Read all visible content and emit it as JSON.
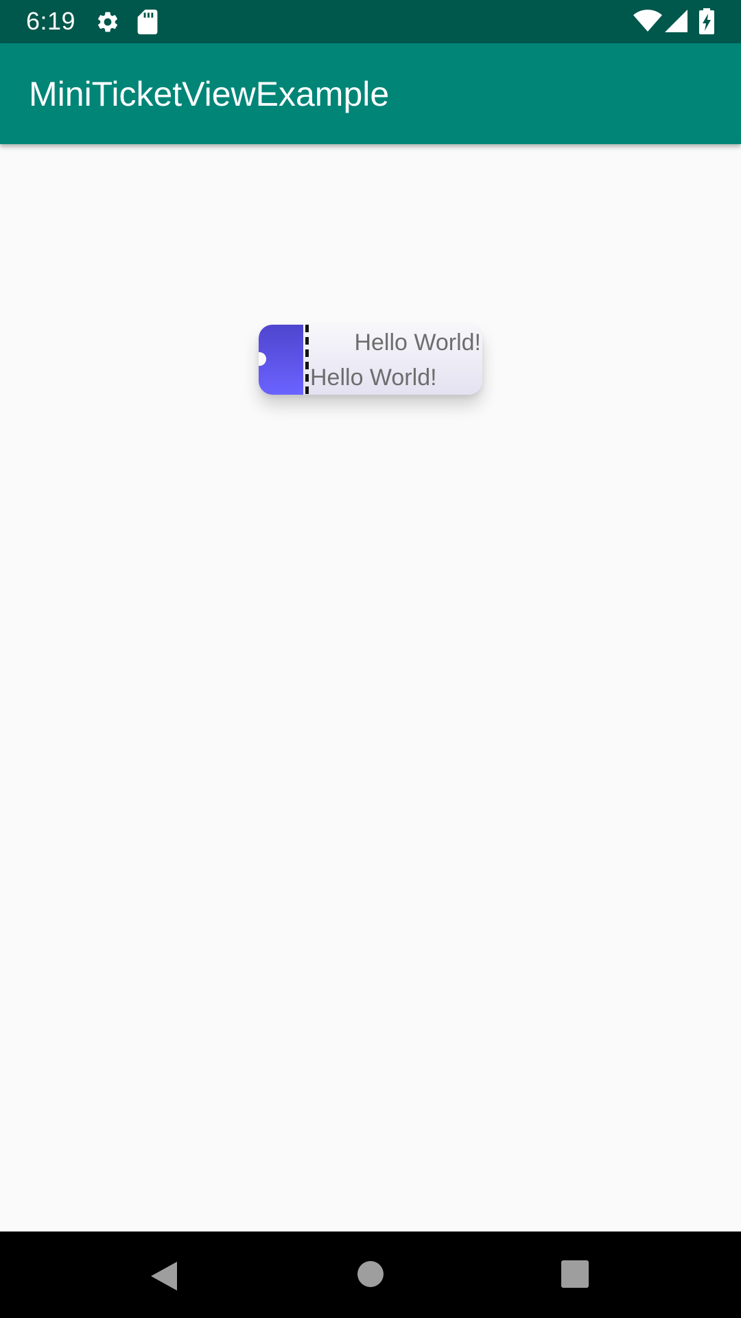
{
  "status_bar": {
    "time": "6:19",
    "icons": [
      "settings-icon",
      "sd-card-icon",
      "wifi-icon",
      "cell-signal-icon",
      "battery-charging-icon"
    ],
    "background": "#00574b"
  },
  "app_bar": {
    "title": "MiniTicketViewExample",
    "background": "#008577"
  },
  "ticket": {
    "line_1": "Hello World!",
    "line_2": "Hello World!",
    "stub_color_top": "#4f45cf",
    "stub_color_bottom": "#6b63ff",
    "text_color": "#6d6d6d"
  },
  "nav_bar": {
    "buttons": [
      "back-icon",
      "home-icon",
      "recents-icon"
    ],
    "background": "#000000"
  }
}
